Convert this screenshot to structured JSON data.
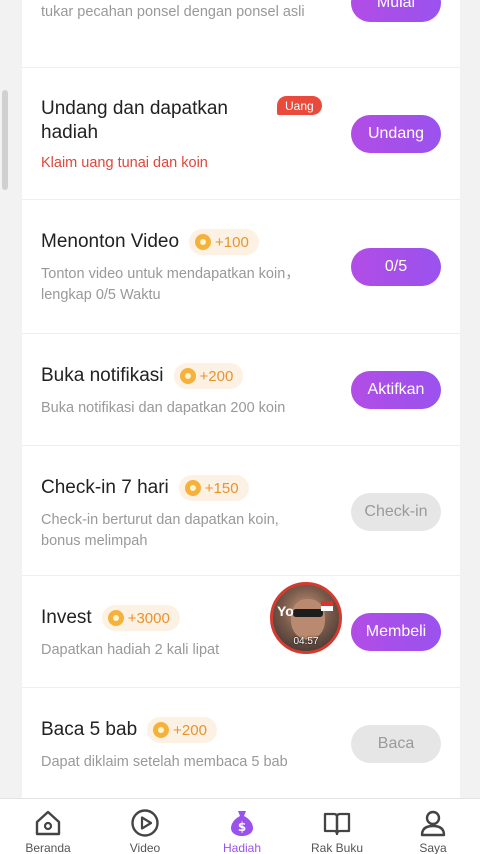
{
  "tasks": [
    {
      "id": "swap",
      "description": "tukar pecahan ponsel dengan ponsel asli",
      "button": "Mulai"
    },
    {
      "id": "invite",
      "title": "Undang dan dapatkan hadiah",
      "badge": "Uang",
      "description": "Klaim uang tunai dan koin",
      "button": "Undang"
    },
    {
      "id": "watch",
      "title": "Menonton Video",
      "reward": "+100",
      "description": "Tonton video untuk mendapatkan koin，lengkap 0/5 Waktu",
      "button": "0/5"
    },
    {
      "id": "notif",
      "title": "Buka notifikasi",
      "reward": "+200",
      "description": "Buka notifikasi dan dapatkan 200 koin",
      "button": "Aktifkan"
    },
    {
      "id": "checkin",
      "title": "Check-in 7 hari",
      "reward": "+150",
      "description": "Check-in berturut dan dapatkan koin, bonus melimpah",
      "button": "Check-in"
    },
    {
      "id": "invest",
      "title": "Invest",
      "reward": "+3000",
      "description": "Dapatkan hadiah 2 kali lipat",
      "button": "Membeli"
    },
    {
      "id": "read",
      "title": "Baca 5 bab",
      "reward": "+200",
      "description": "Dapat diklaim setelah membaca 5 bab",
      "button": "Baca"
    }
  ],
  "floating_video": {
    "logo": "Yo",
    "duration": "04:57"
  },
  "nav": {
    "items": [
      {
        "label": "Beranda",
        "icon": "home-icon"
      },
      {
        "label": "Video",
        "icon": "play-icon"
      },
      {
        "label": "Hadiah",
        "icon": "money-bag-icon",
        "active": true
      },
      {
        "label": "Rak Buku",
        "icon": "book-icon"
      },
      {
        "label": "Saya",
        "icon": "person-icon"
      }
    ]
  },
  "colors": {
    "accent": "#9a52ee",
    "coin": "#f5b23b",
    "reward_text": "#e8932e",
    "badge": "#ea4a3c",
    "disabled": "#e6e6e6"
  }
}
